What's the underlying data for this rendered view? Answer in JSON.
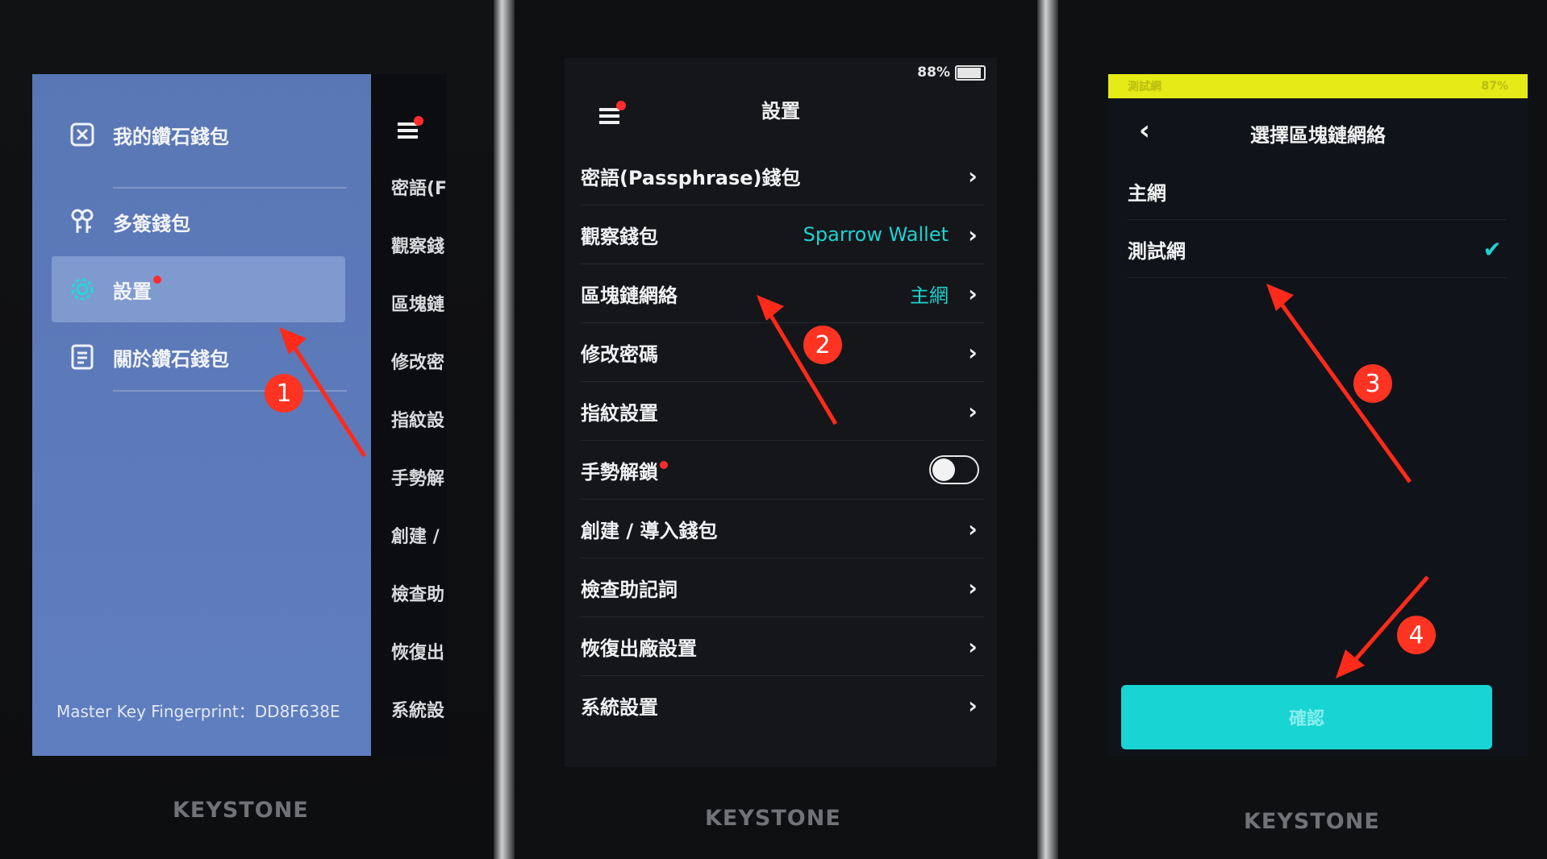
{
  "screen1": {
    "menu": [
      {
        "label": "我的鑽石錢包",
        "icon": "wallet-icon"
      },
      {
        "label": "多簽錢包",
        "icon": "multisig-icon"
      },
      {
        "label": "設置",
        "icon": "gear-icon",
        "badge": true
      },
      {
        "label": "關於鑽石錢包",
        "icon": "document-icon"
      }
    ],
    "fingerprint": "Master Key Fingerprint：DD8F638E",
    "peek": [
      "密語(F",
      "觀察錢",
      "區塊鏈",
      "修改密",
      "指紋設",
      "手勢解",
      "創建 /",
      "檢查助",
      "恢復出",
      "系統設"
    ]
  },
  "screen2": {
    "battery": "88%",
    "title": "設置",
    "rows": [
      {
        "label": "密語(Passphrase)錢包",
        "value": ""
      },
      {
        "label": "觀察錢包",
        "value": "Sparrow Wallet"
      },
      {
        "label": "區塊鏈網絡",
        "value": "主網"
      },
      {
        "label": "修改密碼",
        "value": ""
      },
      {
        "label": "指紋設置",
        "value": ""
      },
      {
        "label": "手勢解鎖",
        "value": ""
      },
      {
        "label": "創建 / 導入錢包",
        "value": ""
      },
      {
        "label": "檢查助記詞",
        "value": ""
      },
      {
        "label": "恢復出廠設置",
        "value": ""
      },
      {
        "label": "系統設置",
        "value": ""
      }
    ],
    "gesture_toggle": "off"
  },
  "screen3": {
    "banner_left": "測試網",
    "banner_right": "87%",
    "title": "選擇區塊鏈網絡",
    "options": [
      {
        "label": "主網",
        "selected": false
      },
      {
        "label": "測試網",
        "selected": true
      }
    ],
    "confirm": "確認"
  },
  "brand": "KEYSTONE",
  "badges": [
    "1",
    "2",
    "3",
    "4"
  ],
  "colors": {
    "accent": "#1fd1d1",
    "annotation": "#ff3322",
    "testnet_banner": "#e6ea16"
  }
}
